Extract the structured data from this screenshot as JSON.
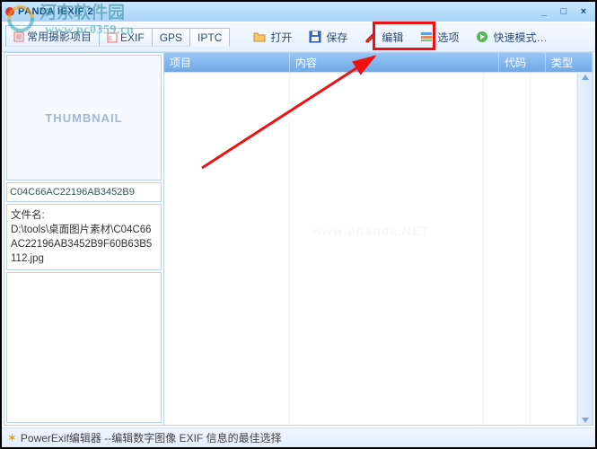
{
  "titlebar": {
    "title": "PANDA IEXIF 2"
  },
  "watermark": {
    "line1": "河东软件园",
    "line2": "www.pc0359.cn"
  },
  "tabs": [
    {
      "label": "常用摄影项目",
      "active": false
    },
    {
      "label": "EXIF",
      "active": false
    },
    {
      "label": "GPS",
      "active": false
    },
    {
      "label": "IPTC",
      "active": true
    }
  ],
  "toolbar": {
    "open": "打开",
    "save": "保存",
    "edit": "编辑",
    "options": "选项",
    "quick_mode": "快速模式…"
  },
  "left": {
    "thumbnail_label": "THUMBNAIL",
    "file_id": "C04C66AC22196AB3452B9",
    "file_name_label": "文件名:",
    "file_path": "D:\\tools\\桌面图片素材\\C04C66AC22196AB3452B9F60B63B5112.jpg"
  },
  "grid": {
    "columns": {
      "item": "项目",
      "content": "内容",
      "code": "代码",
      "type": "类型"
    },
    "center_watermark": "www.opanda.NET"
  },
  "statusbar": {
    "text": "PowerExif编辑器 --编辑数字图像 EXIF 信息的最佳选择"
  }
}
